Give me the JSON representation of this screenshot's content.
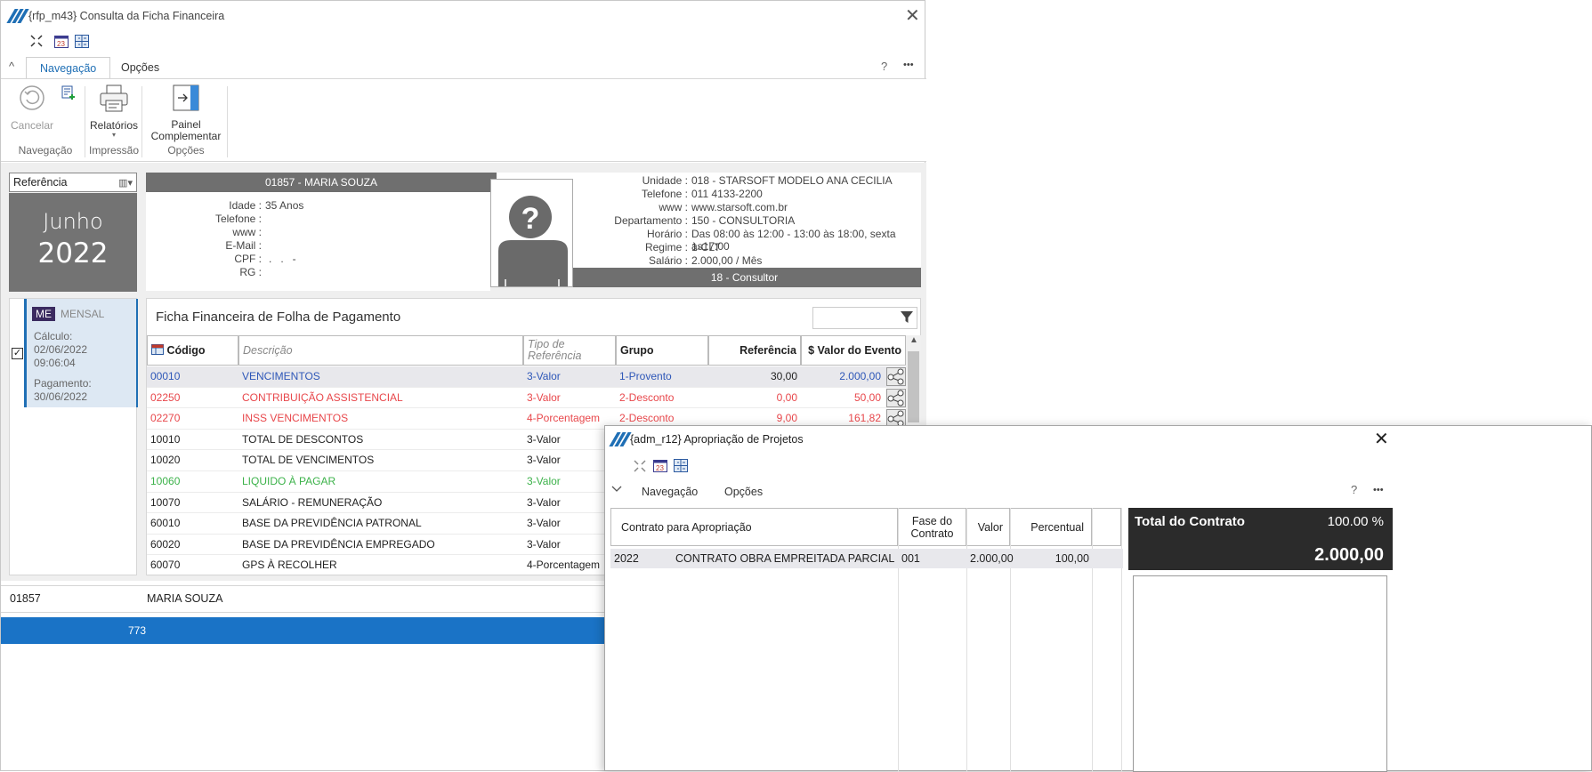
{
  "main": {
    "title": "{rfp_m43}  Consulta da Ficha Financeira",
    "tabs": [
      {
        "label": "Navegação"
      },
      {
        "label": "Opções"
      }
    ],
    "help": "?",
    "more": "•••",
    "ribbon": {
      "cancel": "Cancelar",
      "reports": "Relatórios",
      "reports_caret": "▾",
      "panel_line1": "Painel",
      "panel_line2": "Complementar",
      "groups": [
        "Navegação",
        "Impressão",
        "Opções"
      ]
    },
    "reference": {
      "label": "Referência",
      "month": "Junho",
      "year": "2022"
    },
    "calc": {
      "badge": "ME",
      "type": "MENSAL",
      "calc_label": "Cálculo:",
      "calc_date": "02/06/2022",
      "calc_time": "09:06:04",
      "pay_label": "Pagamento:",
      "pay_date": "30/06/2022"
    },
    "employee": {
      "header": "01857 - MARIA SOUZA",
      "labels": [
        "Idade :",
        "Telefone :",
        "www :",
        "E-Mail :",
        "CPF :",
        "RG :"
      ],
      "values": [
        "35 Anos",
        "",
        "",
        "",
        ".   .   -",
        ""
      ],
      "role": "18 - Consultor"
    },
    "company": {
      "labels": [
        "Unidade :",
        "Telefone :",
        "www :",
        "Departamento :",
        "Horário :",
        "Regime :",
        "Salário :"
      ],
      "values": [
        "018 - STARSOFT MODELO ANA CECILIA",
        "011 4133-2200",
        "www.starsoft.com.br",
        "150 - CONSULTORIA",
        "Das 08:00 às 12:00 - 13:00 às 18:00, sexta às17:00",
        "1-CLT",
        "2.000,00 / Mês"
      ]
    },
    "grid": {
      "title": "Ficha Financeira de Folha de Pagamento",
      "columns": {
        "codigo": "Código",
        "descricao": "Descrição",
        "tipo1": "Tipo de",
        "tipo2": "Referência",
        "grupo": "Grupo",
        "referencia": "Referência",
        "valor": "$ Valor do Evento"
      },
      "rows": [
        {
          "codigo": "00010",
          "descricao": "VENCIMENTOS",
          "tipo": "3-Valor",
          "grupo": "1-Provento",
          "referencia": "30,00",
          "valor": "2.000,00",
          "color": "#2e57b8",
          "selected": true,
          "share": true
        },
        {
          "codigo": "02250",
          "descricao": "CONTRIBUIÇÃO ASSISTENCIAL",
          "tipo": "3-Valor",
          "grupo": "2-Desconto",
          "referencia": "0,00",
          "valor": "50,00",
          "color": "#e8474b",
          "selected": false,
          "share": true
        },
        {
          "codigo": "02270",
          "descricao": "INSS VENCIMENTOS",
          "tipo": "4-Porcentagem",
          "grupo": "2-Desconto",
          "referencia": "9,00",
          "valor": "161,82",
          "color": "#e8474b",
          "selected": false,
          "share": true
        },
        {
          "codigo": "10010",
          "descricao": "TOTAL DE DESCONTOS",
          "tipo": "3-Valor",
          "grupo": "",
          "referencia": "",
          "valor": "",
          "color": "#222222",
          "selected": false,
          "share": false
        },
        {
          "codigo": "10020",
          "descricao": "TOTAL DE VENCIMENTOS",
          "tipo": "3-Valor",
          "grupo": "",
          "referencia": "",
          "valor": "",
          "color": "#222222",
          "selected": false,
          "share": false
        },
        {
          "codigo": "10060",
          "descricao": "LIQUIDO À PAGAR",
          "tipo": "3-Valor",
          "grupo": "",
          "referencia": "",
          "valor": "",
          "color": "#3cb24a",
          "selected": false,
          "share": false
        },
        {
          "codigo": "10070",
          "descricao": "SALÁRIO - REMUNERAÇÃO",
          "tipo": "3-Valor",
          "grupo": "",
          "referencia": "",
          "valor": "",
          "color": "#222222",
          "selected": false,
          "share": false
        },
        {
          "codigo": "60010",
          "descricao": "BASE DA PREVIDÊNCIA PATRONAL",
          "tipo": "3-Valor",
          "grupo": "",
          "referencia": "",
          "valor": "",
          "color": "#222222",
          "selected": false,
          "share": false
        },
        {
          "codigo": "60020",
          "descricao": "BASE DA PREVIDÊNCIA EMPREGADO",
          "tipo": "3-Valor",
          "grupo": "",
          "referencia": "",
          "valor": "",
          "color": "#222222",
          "selected": false,
          "share": false
        },
        {
          "codigo": "60070",
          "descricao": "GPS À RECOLHER",
          "tipo": "4-Porcentagem",
          "grupo": "",
          "referencia": "",
          "valor": "",
          "color": "#222222",
          "selected": false,
          "share": false
        }
      ]
    },
    "footer": {
      "code": "01857",
      "name": "MARIA SOUZA"
    },
    "status": {
      "value": "773"
    }
  },
  "dialog": {
    "title": "{adm_r12}  Apropriação de Projetos",
    "tabs": [
      {
        "label": "Navegação"
      },
      {
        "label": "Opções"
      }
    ],
    "help": "?",
    "more": "•••",
    "columns": {
      "contrato": "Contrato para Apropriação",
      "fase1": "Fase do",
      "fase2": "Contrato",
      "valor": "Valor",
      "percentual": "Percentual"
    },
    "row": {
      "codigo": "2022",
      "contrato": "CONTRATO OBRA EMPREITADA PARCIAL",
      "fase": "001",
      "valor": "2.000,00",
      "percentual": "100,00"
    },
    "total": {
      "label": "Total do Contrato",
      "percent": "100.00 %",
      "value": "2.000,00"
    }
  },
  "colors": {
    "accent": "#1f6fb5",
    "status_bar": "#1a73c6",
    "header_grey": "#6f6f6f",
    "provento": "#2e57b8",
    "desconto": "#e8474b",
    "liquido": "#3cb24a"
  }
}
